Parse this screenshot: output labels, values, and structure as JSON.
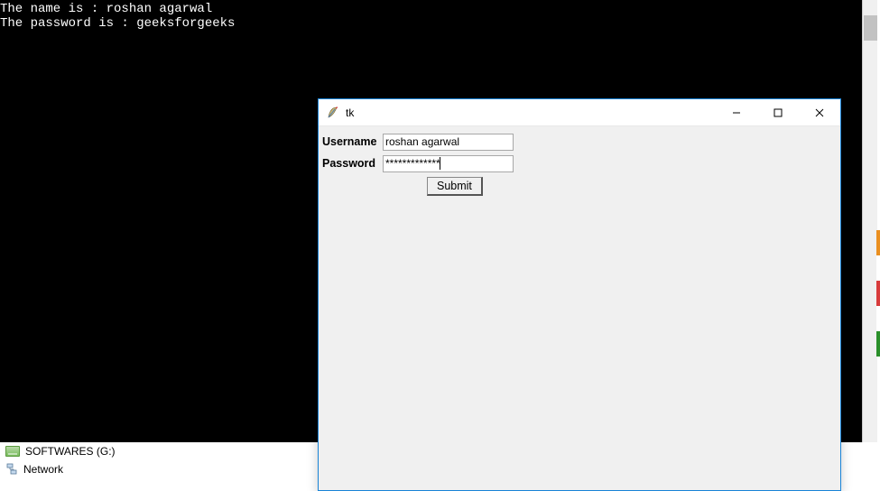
{
  "terminal": {
    "line1": "The name is : roshan agarwal",
    "line2": "The password is : geeksforgeeks"
  },
  "desktop": {
    "drive_label": "SOFTWARES (G:)",
    "network_label": "Network"
  },
  "tk_window": {
    "title": "tk",
    "form": {
      "username_label": "Username",
      "username_value": "roshan agarwal",
      "password_label": "Password",
      "password_value": "*************",
      "submit_label": "Submit"
    }
  }
}
